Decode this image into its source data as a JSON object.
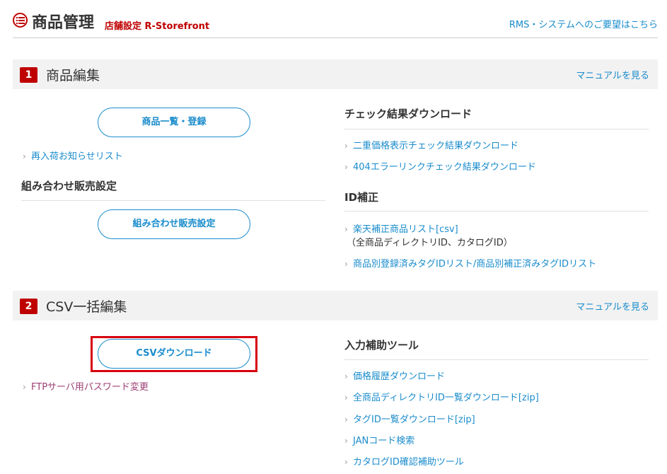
{
  "header": {
    "title": "商品管理",
    "subtitle": "店舗設定 R-Storefront",
    "request_link": "RMS・システムへのご要望はこちら"
  },
  "section1": {
    "number": "1",
    "title": "商品編集",
    "manual_link": "マニュアルを見る",
    "product_list_button": "商品一覧・登録",
    "restock_link": "再入荷お知らせリスト",
    "bundle_heading": "組み合わせ販売設定",
    "bundle_button": "組み合わせ販売設定",
    "check_heading": "チェック結果ダウンロード",
    "check_links": [
      "二重価格表示チェック結果ダウンロード",
      "404エラーリンクチェック結果ダウンロード"
    ],
    "id_heading": "ID補正",
    "id_links": [
      "楽天補正商品リスト[csv]",
      "商品別登録済みタグIDリスト/商品別補正済みタグIDリスト"
    ],
    "id_note": "（全商品ディレクトリID、カタログID）"
  },
  "section2": {
    "number": "2",
    "title": "CSV一括編集",
    "manual_link": "マニュアルを見る",
    "csv_button": "CSVダウンロード",
    "ftp_link": "FTPサーバ用パスワード変更",
    "tools_heading": "入力補助ツール",
    "tools_links": [
      "価格履歴ダウンロード",
      "全商品ディレクトリID一覧ダウンロード[zip]",
      "タグID一覧ダウンロード[zip]",
      "JANコード検索",
      "カタログID確認補助ツール"
    ]
  },
  "colors": {
    "brand_red": "#bf0000",
    "link_blue": "#1a8ccc",
    "visited_purple": "#9c3f72",
    "highlight_red": "#d7000f"
  }
}
